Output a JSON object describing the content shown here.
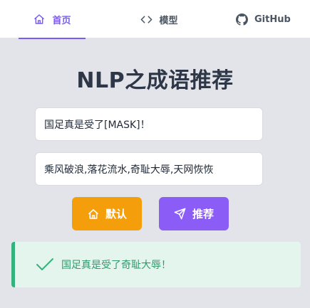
{
  "nav": {
    "tabs": [
      {
        "label": "首页",
        "icon": "home-icon",
        "active": true
      },
      {
        "label": "模型",
        "icon": "code-icon",
        "active": false
      },
      {
        "label": "GitHub",
        "icon": "github-icon",
        "active": false
      }
    ]
  },
  "main": {
    "title": "NLP之成语推荐",
    "input_sentence": {
      "value": "国足真是受了[MASK]！"
    },
    "input_candidates": {
      "value": "乘风破浪,落花流水,奇耻大辱,天网恢恢"
    },
    "buttons": {
      "default": {
        "label": "默认",
        "icon": "home-icon",
        "color": "#f59e0b"
      },
      "recommend": {
        "label": "推荐",
        "icon": "send-icon",
        "color": "#8b5cf6"
      }
    },
    "result": {
      "icon": "check-icon",
      "text": "国足真是受了奇耻大辱！"
    }
  },
  "colors": {
    "accent": "#7c5cf0",
    "background": "#e3e4e9",
    "success": "#34b27b",
    "success_bg": "#e4f5ee"
  }
}
